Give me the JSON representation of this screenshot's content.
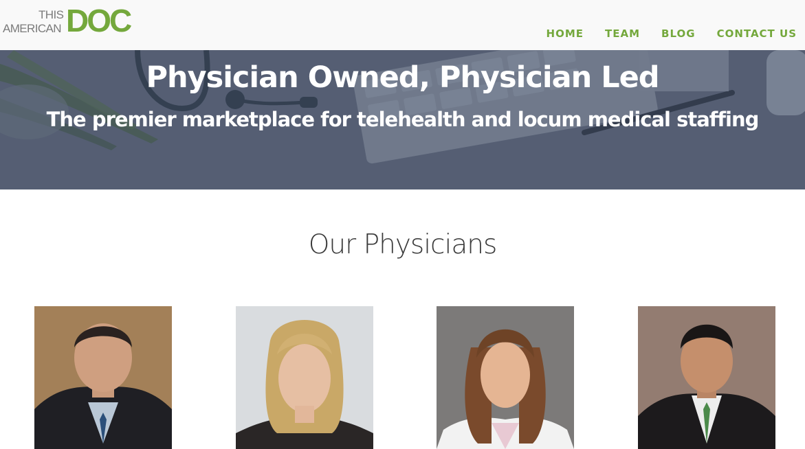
{
  "logo": {
    "line1": "THIS",
    "line2": "AMERICAN",
    "mark": "DOC"
  },
  "nav": {
    "items": [
      "HOME",
      "TEAM",
      "BLOG",
      "CONTACT US"
    ]
  },
  "hero": {
    "title": "Physician Owned, Physician Led",
    "subtitle": "The premier marketplace for telehealth and locum medical staffing"
  },
  "section": {
    "title": "Our Physicians"
  },
  "colors": {
    "brand_green": "#74a83c",
    "hero_overlay": "#5b6478",
    "header_bg": "#f9f9f9"
  }
}
